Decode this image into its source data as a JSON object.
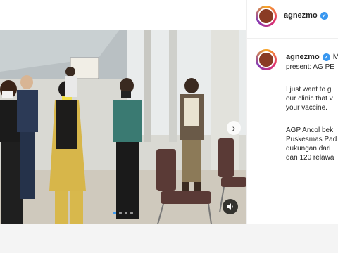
{
  "header": {
    "username": "agnezmo"
  },
  "caption": {
    "username": "agnezmo",
    "first_line_tail": "M",
    "lines": [
      "present: AG PE",
      "I just want to g",
      "our clinic that v",
      "your vaccine.",
      "AGP Ancol bek",
      "Puskesmas Pad",
      "dukungan dari",
      "dan 120 relawa"
    ]
  },
  "media": {
    "slide_count": 4,
    "active_slide": 1
  },
  "icons": {
    "verified": "verified-badge-icon",
    "next": "chevron-right-icon",
    "audio": "audio-muted-icon"
  },
  "colors": {
    "accent": "#3897f0"
  }
}
